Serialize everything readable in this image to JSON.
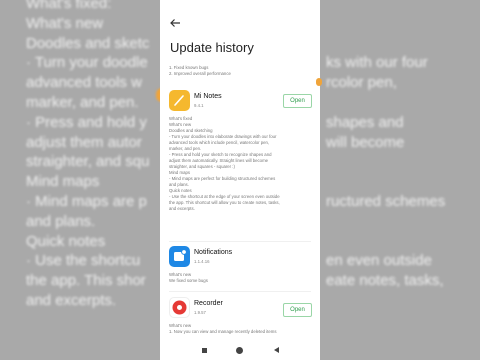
{
  "background": {
    "lines": [
      "What's fixed:",
      "What's new",
      "Doodles and sketc",
      "· Turn your doodle",
      "advanced tools w",
      "marker, and pen.",
      "· Press and hold y",
      "adjust them autor",
      "straighter, and squ",
      "Mind maps",
      "· Mind maps are p",
      "and plans.",
      "Quick notes",
      "· Use the shortcu",
      "the app. This shor",
      "and excerpts."
    ],
    "right_lines": [
      "",
      "",
      "",
      "ks with our four",
      "rcolor pen,",
      "",
      "shapes and",
      "will become",
      "",
      "",
      "ructured schemes",
      "",
      "",
      "en even outside",
      "eate notes, tasks,",
      ""
    ]
  },
  "header": {
    "back_icon": "back-arrow-icon",
    "title": "Update history"
  },
  "previous_notes": [
    "1. Fixed known bugs",
    "2. Improved overall performance"
  ],
  "apps": [
    {
      "name": "Mi Notes",
      "version": "9.4.1",
      "icon": "notes-icon",
      "icon_color": "#f5b82e",
      "open_label": "Open",
      "notes": [
        "What's fixed",
        "What's new",
        "Doodles and sketching",
        "- Turn your doodles into elaborate drawings with our four",
        "advanced tools which include pencil, watercolor pen,",
        "marker, and pen.",
        "- Press and hold your sketch to recognize shapes and",
        "adjust them automatically. Straight lines will become",
        "straighter, and squares - squarer :)",
        "Mind maps",
        "- Mind maps are perfect for building structured schemes",
        "and plans.",
        "Quick notes",
        "- Use the shortcut at the edge of your screen even outside",
        "the app. This shortcut will allow you to create notes, tasks,",
        "and excerpts."
      ]
    },
    {
      "name": "Notifications",
      "version": "1.1.4.16",
      "icon": "notifications-icon",
      "icon_color": "#1e88e5",
      "notes": [
        "What's new",
        "We fixed some bugs"
      ]
    },
    {
      "name": "Recorder",
      "version": "1.9.57",
      "icon": "recorder-icon",
      "icon_color": "#e53935",
      "open_label": "Open",
      "notes": [
        "What's new",
        "1. Now you can view and manage recently deleted items"
      ]
    }
  ],
  "navbar": {
    "recents_icon": "recents-square-icon",
    "home_icon": "home-circle-icon",
    "back_icon": "back-triangle-icon"
  }
}
